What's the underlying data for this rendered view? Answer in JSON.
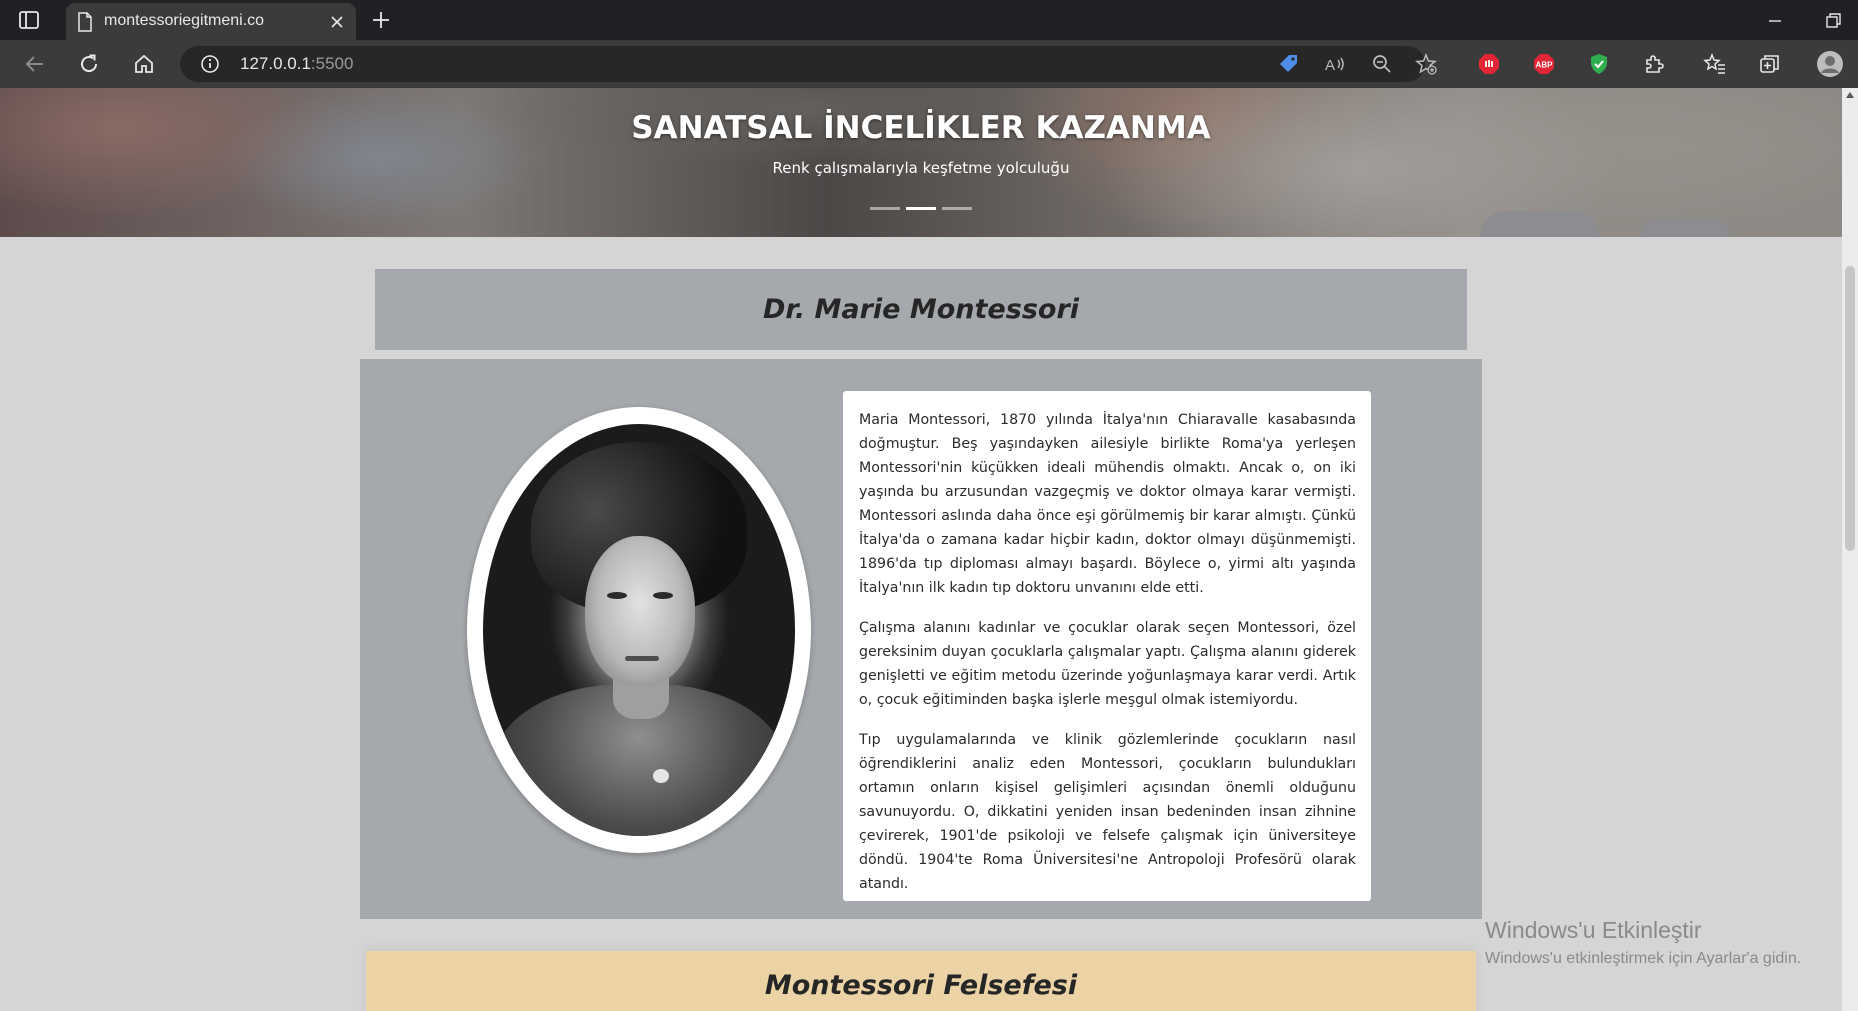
{
  "browser": {
    "tab_title": "montessoriegitmeni.co",
    "url_host": "127.0.0.1",
    "url_port": ":5500"
  },
  "hero": {
    "title": "SANATSAL İNCELİKLER KAZANMA",
    "subtitle": "Renk çalışmalarıyla keşfetme yolculuğu",
    "slide_count": 3,
    "active_slide": 2
  },
  "section_bio": {
    "heading": "Dr. Marie Montessori",
    "paragraphs": [
      "Maria Montessori, 1870 yılında İtalya'nın Chiaravalle kasabasında doğmuştur. Beş yaşındayken ailesiyle birlikte Roma'ya yerleşen Montessori'nin küçükken ideali mühendis olmaktı. Ancak o, on iki yaşında bu arzusundan vazgeçmiş ve doktor olmaya karar vermişti. Montessori aslında daha önce eşi görülmemiş bir karar almıştı. Çünkü İtalya'da o zamana kadar hiçbir kadın, doktor olmayı düşünmemişti. 1896'da tıp diploması almayı başardı. Böylece o, yirmi altı yaşında İtalya'nın ilk kadın tıp doktoru unvanını elde etti.",
      "Çalışma alanını kadınlar ve çocuklar olarak seçen Montessori, özel gereksinim duyan çocuklarla çalışmalar yaptı. Çalışma alanını giderek genişletti ve eğitim metodu üzerinde yoğunlaşmaya karar verdi. Artık o, çocuk eğitiminden başka işlerle meşgul olmak istemiyordu.",
      "Tıp uygulamalarında ve klinik gözlemlerinde çocukların nasıl öğrendiklerini analiz eden Montessori, çocukların bulundukları ortamın onların kişisel gelişimleri açısından önemli olduğunu savunuyordu. O, dikkatini yeniden insan bedeninden insan zihnine çevirerek, 1901'de psikoloji ve felsefe çalışmak için üniversiteye döndü. 1904'te Roma Üniversitesi'ne Antropoloji Profesörü olarak atandı."
    ]
  },
  "section_philosophy": {
    "heading": "Montessori Felsefesi"
  },
  "windows_activation": {
    "title": "Windows'u Etkinleştir",
    "subtitle": "Windows'u etkinleştirmek için Ayarlar'a gidin."
  },
  "colors": {
    "page_bg": "#d5d5d5",
    "section_gray": "#a5a8ac",
    "section_beige": "#ebd3a5",
    "chrome_dark": "#202124",
    "chrome_toolbar": "#3b3b3b"
  }
}
